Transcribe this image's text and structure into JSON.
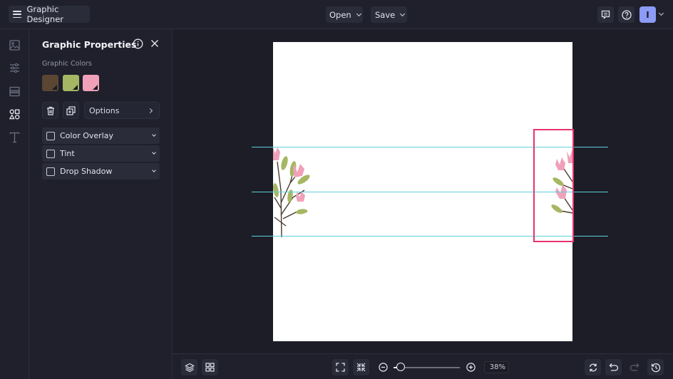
{
  "topbar": {
    "app_title": "Graphic Designer",
    "open_label": "Open",
    "save_label": "Save",
    "avatar_initial": "I",
    "icons": [
      "menu-icon",
      "comment-icon",
      "help-icon",
      "chevron-down-icon"
    ]
  },
  "rail": {
    "items": [
      {
        "name": "image",
        "icon": "image-icon"
      },
      {
        "name": "adjustments",
        "icon": "sliders-icon"
      },
      {
        "name": "layout",
        "icon": "layout-icon"
      },
      {
        "name": "graphics",
        "icon": "shapes-icon",
        "active": true
      },
      {
        "name": "text",
        "icon": "text-icon"
      }
    ]
  },
  "panel": {
    "title": "Graphic Properties",
    "colors_label": "Graphic Colors",
    "colors": [
      "#5a4632",
      "#a5b762",
      "#f0a0b8"
    ],
    "options_label": "Options",
    "effects": [
      {
        "label": "Color Overlay",
        "checked": false
      },
      {
        "label": "Tint",
        "checked": false
      },
      {
        "label": "Drop Shadow",
        "checked": false
      }
    ]
  },
  "colors": {
    "accent": "#8b9bf6",
    "guide": "#5fd0dc",
    "selection": "#e8336e",
    "background": "#1c1d27"
  },
  "bottombar": {
    "zoom_value": "38%",
    "zoom_fraction": 0.1
  }
}
